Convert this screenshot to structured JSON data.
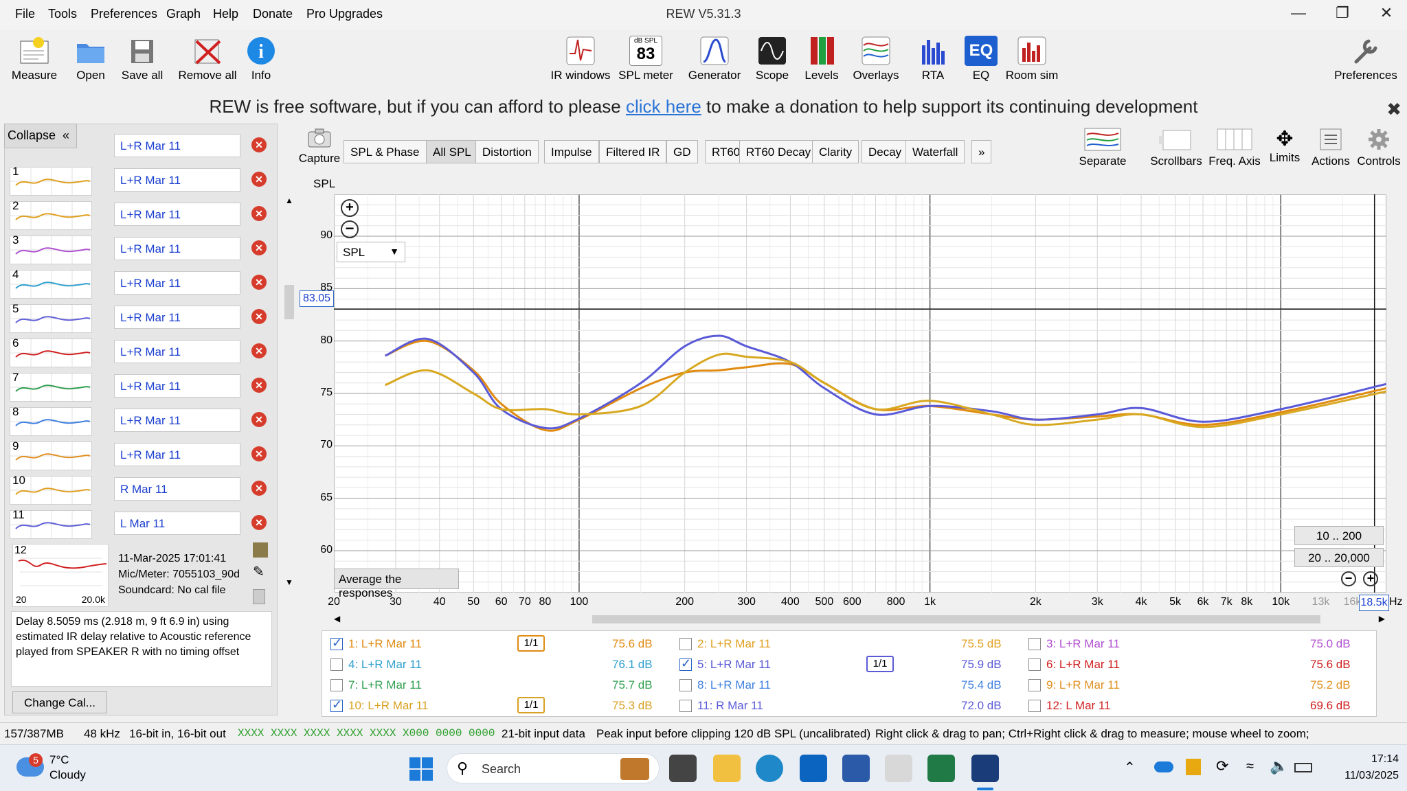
{
  "window": {
    "title": "REW V5.31.3"
  },
  "menu": [
    "File",
    "Tools",
    "Preferences",
    "Graph",
    "Help",
    "Donate",
    "Pro Upgrades"
  ],
  "toolbar_left": [
    "Measure",
    "Open",
    "Save all",
    "Remove all",
    "Info"
  ],
  "toolbar_center": [
    "IR windows",
    "SPL meter",
    "Generator",
    "Scope",
    "Levels",
    "Overlays",
    "RTA",
    "EQ",
    "Room sim"
  ],
  "spl_meter_icon": {
    "unit": "dB SPL",
    "value": "83"
  },
  "preferences_label": "Preferences",
  "donation": {
    "before": "REW is free software, but if you can afford to please ",
    "link": "click here",
    "after": " to make a donation to help support its continuing development"
  },
  "left_panel": {
    "collapse_label": "Collapse",
    "top_name": "L+R Mar 11",
    "measurements": [
      {
        "num": "1",
        "name": "L+R Mar 11",
        "color": "#e0a020"
      },
      {
        "num": "2",
        "name": "L+R Mar 11",
        "color": "#e0a020"
      },
      {
        "num": "3",
        "name": "L+R Mar 11",
        "color": "#b050d0"
      },
      {
        "num": "4",
        "name": "L+R Mar 11",
        "color": "#30a0d0"
      },
      {
        "num": "5",
        "name": "L+R Mar 11",
        "color": "#6060d8"
      },
      {
        "num": "6",
        "name": "L+R Mar 11",
        "color": "#d02020"
      },
      {
        "num": "7",
        "name": "L+R Mar 11",
        "color": "#30a050"
      },
      {
        "num": "8",
        "name": "L+R Mar 11",
        "color": "#4080e0"
      },
      {
        "num": "9",
        "name": "L+R Mar 11",
        "color": "#e09020"
      },
      {
        "num": "10",
        "name": "R Mar 11",
        "color": "#e0a020"
      },
      {
        "num": "11",
        "name": "L Mar 11",
        "color": "#6060d8"
      }
    ],
    "selected": {
      "num": "12",
      "date": "11-Mar-2025 17:01:41",
      "mic": "Mic/Meter: 7055103_90d",
      "soundcard": "Soundcard: No cal file",
      "thumb_x_min": "20",
      "thumb_x_max": "20.0k"
    },
    "info_text": "Delay 8.5059 ms (2.918 m, 9 ft 6.9 in) using estimated IR delay relative to Acoustic reference played from SPEAKER R with no timing offset",
    "change_cal_label": "Change Cal..."
  },
  "graph": {
    "capture_label": "Capture",
    "tabs": [
      "SPL & Phase",
      "All SPL",
      "Distortion",
      "Impulse",
      "Filtered IR",
      "GD",
      "RT60",
      "RT60 Decay",
      "Clarity",
      "Decay",
      "Waterfall",
      "»"
    ],
    "active_tab": "All SPL",
    "right_tools": [
      "Separate",
      "Scrollbars",
      "Freq. Axis",
      "Limits",
      "Actions",
      "Controls"
    ],
    "y_axis_title": "SPL",
    "spl_dropdown": "SPL",
    "cursor_y_value": "83.05",
    "cursor_x_value": "18.5k",
    "x_unit": "Hz",
    "range_button_1": "10 .. 200",
    "range_button_2": "20 .. 20,000",
    "average_button": "Average the responses",
    "y_ticks": [
      "90",
      "85",
      "80",
      "75",
      "70",
      "65",
      "60"
    ],
    "x_ticks": [
      "20",
      "30",
      "40",
      "50",
      "60",
      "70",
      "80",
      "100",
      "200",
      "300",
      "400",
      "500",
      "600",
      "800",
      "1k",
      "2k",
      "3k",
      "4k",
      "5k",
      "6k",
      "7k",
      "8k",
      "10k",
      "13k",
      "16k"
    ]
  },
  "legend": [
    {
      "label": "1: L+R Mar 11",
      "value": "75.6 dB",
      "checked": true,
      "color": "#e08a10",
      "smoothing": "1/1"
    },
    {
      "label": "2: L+R Mar 11",
      "value": "75.5 dB",
      "checked": false,
      "color": "#e0a020"
    },
    {
      "label": "3: L+R Mar 11",
      "value": "75.0 dB",
      "checked": false,
      "color": "#b050d0"
    },
    {
      "label": "4: L+R Mar 11",
      "value": "76.1 dB",
      "checked": false,
      "color": "#30a0d0"
    },
    {
      "label": "5: L+R Mar 11",
      "value": "75.9 dB",
      "checked": true,
      "color": "#5a5ad8",
      "smoothing": "1/1"
    },
    {
      "label": "6: L+R Mar 11",
      "value": "75.6 dB",
      "checked": false,
      "color": "#d02020"
    },
    {
      "label": "7: L+R Mar 11",
      "value": "75.7 dB",
      "checked": false,
      "color": "#30a050"
    },
    {
      "label": "8: L+R Mar 11",
      "value": "75.4 dB",
      "checked": false,
      "color": "#4080e0"
    },
    {
      "label": "9: L+R Mar 11",
      "value": "75.2 dB",
      "checked": false,
      "color": "#e09020"
    },
    {
      "label": "10: L+R Mar 11",
      "value": "75.3 dB",
      "checked": true,
      "color": "#d8a020",
      "smoothing": "1/1"
    },
    {
      "label": "11: R Mar 11",
      "value": "72.0 dB",
      "checked": false,
      "color": "#5a5ad8"
    },
    {
      "label": "12: L Mar 11",
      "value": "69.6 dB",
      "checked": false,
      "color": "#d02020"
    }
  ],
  "status": {
    "memory": "157/387MB",
    "rate": "48 kHz",
    "bits": "16-bit in, 16-bit out",
    "levels": "XXXX XXXX   XXXX XXXX   XXXX X000   0000 0000",
    "input": "21-bit input data",
    "peak": "Peak input before clipping 120 dB SPL (uncalibrated)",
    "hint": "Right click & drag to pan; Ctrl+Right click & drag to measure; mouse wheel to zoom;"
  },
  "taskbar": {
    "weather_temp": "7°C",
    "weather_cond": "Cloudy",
    "weather_badge": "5",
    "search_label": "Search",
    "time": "17:14",
    "date": "11/03/2025"
  },
  "chart_data": {
    "type": "line",
    "xlabel": "Hz",
    "ylabel": "SPL",
    "xscale": "log",
    "xlim": [
      20,
      20000
    ],
    "ylim": [
      56,
      94
    ],
    "series": [
      {
        "name": "1: L+R Mar 11",
        "color": "#e08a10",
        "x": [
          28,
          37,
          50,
          60,
          80,
          100,
          150,
          200,
          250,
          300,
          400,
          500,
          700,
          1000,
          1500,
          2000,
          3000,
          4000,
          6000,
          10000,
          20000
        ],
        "y": [
          78.6,
          80.0,
          77.2,
          74.0,
          71.5,
          72.5,
          75.5,
          77.0,
          77.2,
          77.5,
          77.8,
          76.0,
          73.5,
          73.8,
          73.0,
          72.5,
          72.8,
          73.0,
          72.0,
          73.2,
          75.5
        ]
      },
      {
        "name": "5: L+R Mar 11",
        "color": "#5a5ad8",
        "x": [
          28,
          37,
          50,
          60,
          80,
          100,
          150,
          200,
          250,
          300,
          400,
          500,
          700,
          1000,
          1500,
          2000,
          3000,
          4000,
          6000,
          10000,
          20000
        ],
        "y": [
          78.6,
          80.2,
          77.0,
          73.5,
          71.7,
          72.6,
          76.0,
          79.5,
          80.5,
          79.5,
          78.0,
          75.5,
          73.0,
          73.8,
          73.3,
          72.5,
          73.0,
          73.6,
          72.3,
          73.5,
          75.9
        ]
      },
      {
        "name": "10: L+R Mar 11",
        "color": "#d8a820",
        "x": [
          28,
          37,
          50,
          60,
          80,
          100,
          150,
          200,
          250,
          300,
          400,
          500,
          700,
          1000,
          1500,
          2000,
          3000,
          4000,
          6000,
          10000,
          20000
        ],
        "y": [
          75.8,
          77.2,
          75.0,
          73.5,
          73.5,
          73.0,
          73.8,
          77.0,
          78.7,
          78.5,
          78.0,
          76.0,
          73.5,
          74.3,
          73.0,
          72.0,
          72.5,
          73.0,
          71.8,
          73.0,
          75.2
        ]
      }
    ]
  },
  "colors": {
    "accent": "#2a73d6",
    "delete_red": "#d63c2c"
  }
}
